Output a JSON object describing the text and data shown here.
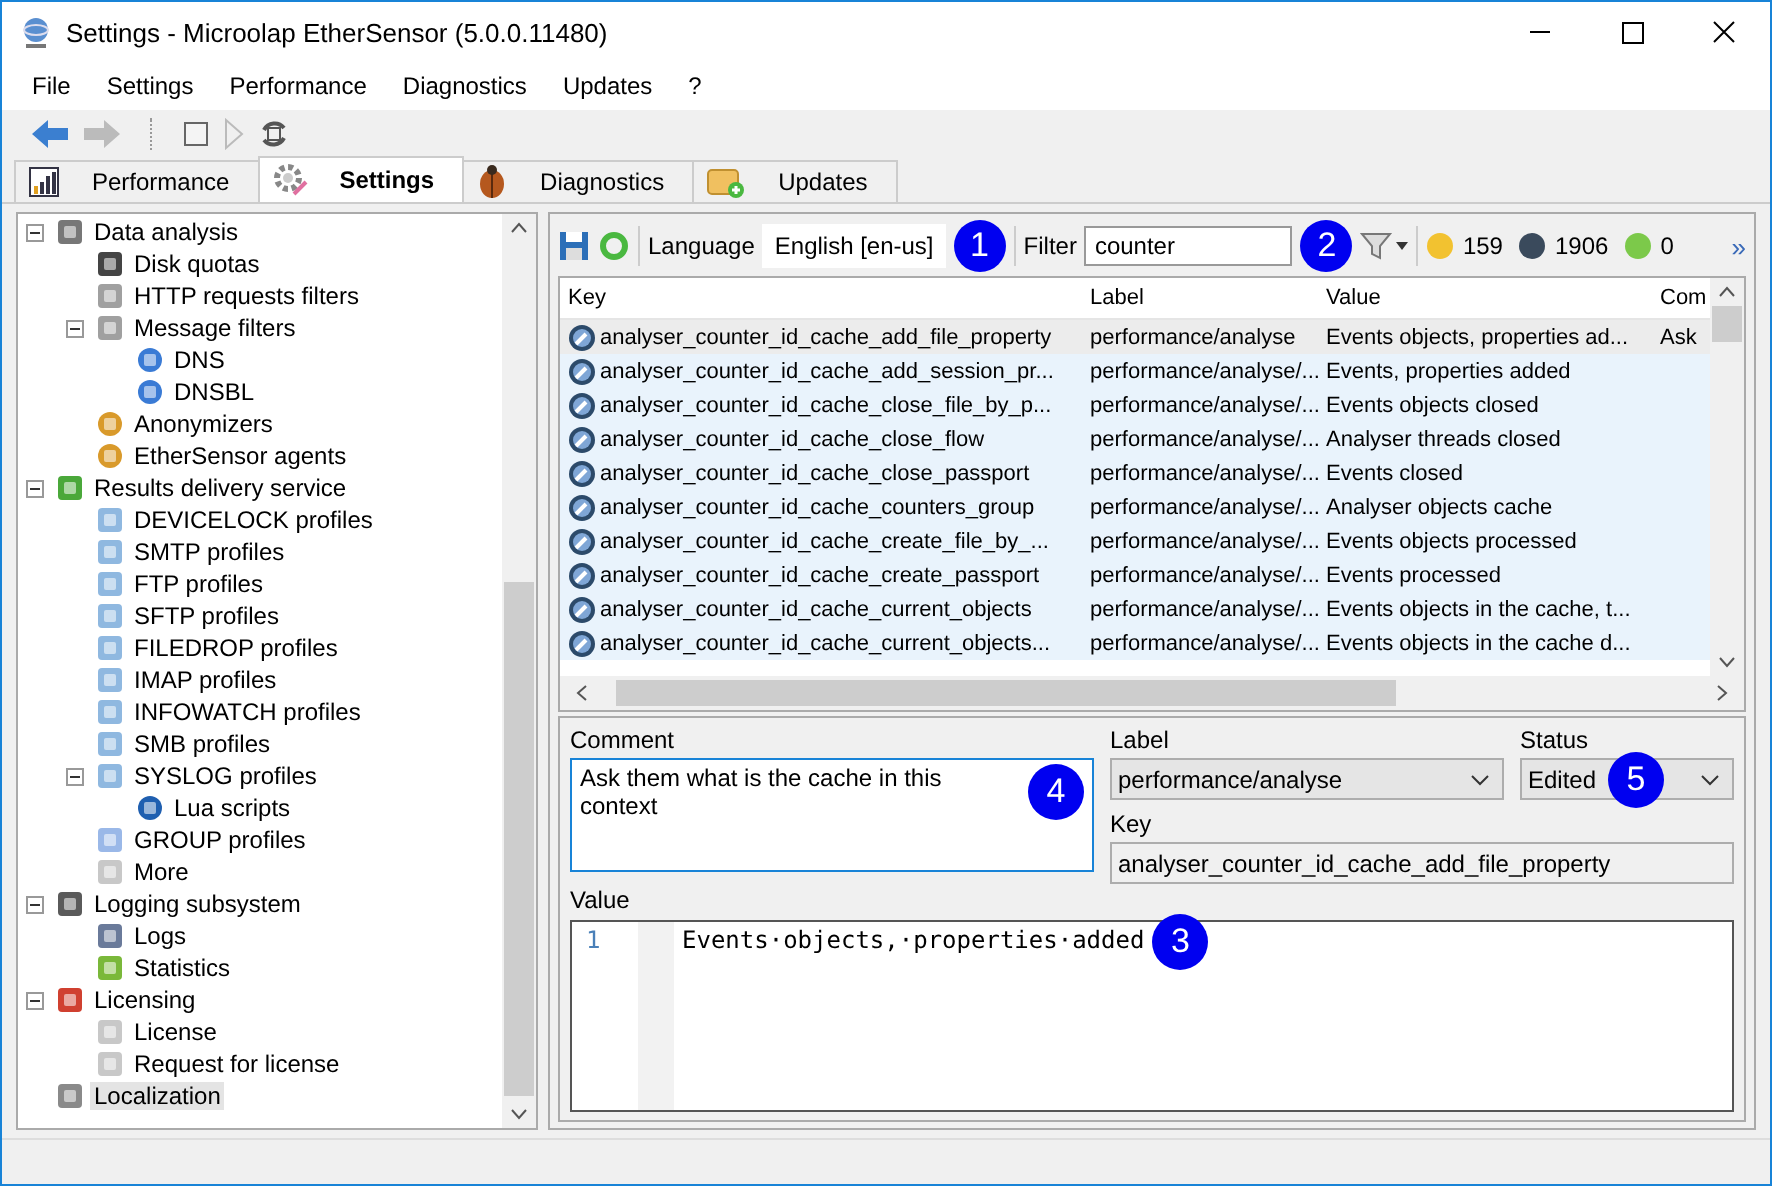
{
  "window": {
    "title": "Settings - Microolap EtherSensor (5.0.0.11480)"
  },
  "menu": [
    "File",
    "Settings",
    "Performance",
    "Diagnostics",
    "Updates",
    "?"
  ],
  "toolbar": [
    {
      "kind": "back",
      "disabled": false
    },
    {
      "kind": "forward",
      "disabled": true
    },
    {
      "kind": "stop",
      "disabled": false
    },
    {
      "kind": "play",
      "disabled": true
    },
    {
      "kind": "refresh",
      "disabled": false
    }
  ],
  "tabs": [
    {
      "label": "Performance",
      "kind": "chart",
      "selected": false
    },
    {
      "label": "Settings",
      "kind": "gear",
      "selected": true
    },
    {
      "label": "Diagnostics",
      "kind": "bug",
      "selected": false
    },
    {
      "label": "Updates",
      "kind": "box",
      "selected": false
    }
  ],
  "tree": {
    "items": [
      {
        "label": "Data analysis",
        "kind": "tools",
        "selected": false,
        "expanded": true,
        "children": [
          {
            "label": "Disk quotas",
            "kind": "disk",
            "selected": false
          },
          {
            "label": "HTTP requests filters",
            "kind": "filter",
            "selected": false
          },
          {
            "label": "Message filters",
            "kind": "filter",
            "selected": false,
            "expanded": true,
            "children": [
              {
                "label": "DNS",
                "kind": "globe",
                "selected": false
              },
              {
                "label": "DNSBL",
                "kind": "globe",
                "selected": false
              }
            ]
          },
          {
            "label": "Anonymizers",
            "kind": "person",
            "selected": false
          },
          {
            "label": "EtherSensor agents",
            "kind": "person",
            "selected": false
          }
        ]
      },
      {
        "label": "Results delivery service",
        "kind": "upload",
        "selected": false,
        "expanded": true,
        "children": [
          {
            "label": "DEVICELOCK profiles",
            "kind": "mail",
            "selected": false
          },
          {
            "label": "SMTP profiles",
            "kind": "mail",
            "selected": false
          },
          {
            "label": "FTP profiles",
            "kind": "mail",
            "selected": false
          },
          {
            "label": "SFTP profiles",
            "kind": "mail",
            "selected": false
          },
          {
            "label": "FILEDROP profiles",
            "kind": "mail",
            "selected": false
          },
          {
            "label": "IMAP profiles",
            "kind": "mail",
            "selected": false
          },
          {
            "label": "INFOWATCH profiles",
            "kind": "mail",
            "selected": false
          },
          {
            "label": "SMB profiles",
            "kind": "mail",
            "selected": false
          },
          {
            "label": "SYSLOG profiles",
            "kind": "mail",
            "selected": false,
            "expanded": true,
            "children": [
              {
                "label": "Lua scripts",
                "kind": "moon",
                "selected": false
              }
            ]
          },
          {
            "label": "GROUP profiles",
            "kind": "group",
            "selected": false
          },
          {
            "label": "More",
            "kind": "page",
            "selected": false
          }
        ]
      },
      {
        "label": "Logging subsystem",
        "kind": "glasses",
        "selected": false,
        "expanded": true,
        "children": [
          {
            "label": "Logs",
            "kind": "pen",
            "selected": false
          },
          {
            "label": "Statistics",
            "kind": "bars",
            "selected": false
          }
        ]
      },
      {
        "label": "Licensing",
        "kind": "certificate",
        "selected": false,
        "expanded": true,
        "children": [
          {
            "label": "License",
            "kind": "page",
            "selected": false
          },
          {
            "label": "Request for license",
            "kind": "page",
            "selected": false
          }
        ]
      },
      {
        "label": "Localization",
        "kind": "gear",
        "selected": true
      }
    ]
  },
  "toolbar2": {
    "language_label": "Language",
    "language": "English [en-us]",
    "language_callout": "1",
    "filter_label": "Filter",
    "filter": "counter",
    "filter_callout": "2",
    "counters": [
      {
        "value": "159",
        "color": "#f2c230"
      },
      {
        "value": "1906",
        "color": "#3a4a5c"
      },
      {
        "value": "0",
        "color": "#7cc94a"
      }
    ],
    "more": "»"
  },
  "table": {
    "columns": [
      "Key",
      "Label",
      "Value",
      "Com"
    ],
    "rows": [
      {
        "selected": true,
        "cells": [
          "analyser_counter_id_cache_add_file_property",
          "performance/analyse",
          "Events objects, properties ad...",
          "Ask"
        ]
      },
      {
        "selected": false,
        "cells": [
          "analyser_counter_id_cache_add_session_pr...",
          "performance/analyse/...",
          "Events, properties added"
        ]
      },
      {
        "selected": false,
        "cells": [
          "analyser_counter_id_cache_close_file_by_p...",
          "performance/analyse/...",
          "Events objects closed"
        ]
      },
      {
        "selected": false,
        "cells": [
          "analyser_counter_id_cache_close_flow",
          "performance/analyse/...",
          "Analyser threads closed"
        ]
      },
      {
        "selected": false,
        "cells": [
          "analyser_counter_id_cache_close_passport",
          "performance/analyse/...",
          "Events closed"
        ]
      },
      {
        "selected": false,
        "cells": [
          "analyser_counter_id_cache_counters_group",
          "performance/analyse/...",
          "Analyser objects cache"
        ]
      },
      {
        "selected": false,
        "cells": [
          "analyser_counter_id_cache_create_file_by_...",
          "performance/analyse/...",
          "Events objects processed"
        ]
      },
      {
        "selected": false,
        "cells": [
          "analyser_counter_id_cache_create_passport",
          "performance/analyse/...",
          "Events processed"
        ]
      },
      {
        "selected": false,
        "cells": [
          "analyser_counter_id_cache_current_objects",
          "performance/analyse/...",
          "Events objects in the cache, t..."
        ]
      },
      {
        "selected": false,
        "cells": [
          "analyser_counter_id_cache_current_objects...",
          "performance/analyse/...",
          "Events objects in the cache d..."
        ]
      }
    ]
  },
  "editor": {
    "comment_label": "Comment",
    "comment": "Ask them what is the cache in this context",
    "comment_callout": "4",
    "label_label": "Label",
    "label": "performance/analyse",
    "status_label": "Status",
    "status": "Edited",
    "status_callout": "5",
    "key_label": "Key",
    "key": "analyser_counter_id_cache_add_file_property",
    "value_label": "Value",
    "line_number": "1",
    "value": "Events·objects,·properties·added",
    "value_callout": "3"
  }
}
